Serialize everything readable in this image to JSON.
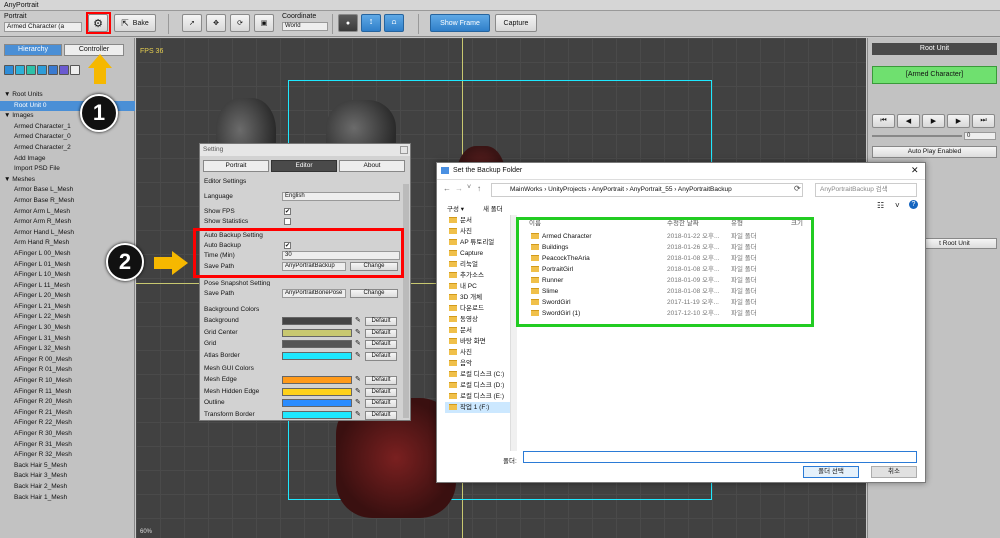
{
  "app": {
    "title": "AnyPortrait"
  },
  "toolbar": {
    "portrait_label": "Portrait",
    "portrait_value": "Armed Character (a",
    "bake": "Bake",
    "coordinate_label": "Coordinate",
    "coordinate_value": "World",
    "show_frame": "Show Frame",
    "capture": "Capture"
  },
  "left": {
    "tab_hierarchy": "Hierarchy",
    "tab_controller": "Controller",
    "tree": [
      "▼ Root Units",
      "Root Unit 0",
      "▼ Images",
      "Armed Character_1",
      "Armed Character_0",
      "Armed Character_2",
      "Add Image",
      "Import PSD File",
      "▼ Meshes",
      "Armor Base L_Mesh",
      "Armor Base R_Mesh",
      "Armor Arm L_Mesh",
      "Armor Arm R_Mesh",
      "Armor Hand L_Mesh",
      "Arm Hand R_Mesh",
      "AFinger L 00_Mesh",
      "AFinger L 01_Mesh",
      "AFinger L 10_Mesh",
      "AFinger L 11_Mesh",
      "AFinger L 20_Mesh",
      "AFinger L 21_Mesh",
      "AFinger L 22_Mesh",
      "AFinger L 30_Mesh",
      "AFinger L 31_Mesh",
      "AFinger L 32_Mesh",
      "AFinger R 00_Mesh",
      "AFinger R 01_Mesh",
      "AFinger R 10_Mesh",
      "AFinger R 11_Mesh",
      "AFinger R 20_Mesh",
      "AFinger R 21_Mesh",
      "AFinger R 22_Mesh",
      "AFinger R 30_Mesh",
      "AFinger R 31_Mesh",
      "AFinger R 32_Mesh",
      "Back Hair 5_Mesh",
      "Back Hair 3_Mesh",
      "Back Hair 2_Mesh",
      "Back Hair 1_Mesh"
    ]
  },
  "viewport": {
    "fps": "FPS 36",
    "zoom": "60%"
  },
  "right": {
    "title": "Root Unit",
    "unit_name": "[Armed Character]",
    "frame_value": "0",
    "auto_play": "Auto Play Enabled",
    "root_unit_btn": "t Root Unit"
  },
  "setting": {
    "title": "Setting",
    "tabs": [
      "Portrait",
      "Editor",
      "About"
    ],
    "editor_settings": "Editor Settings",
    "language_label": "Language",
    "language_value": "English",
    "show_fps": "Show FPS",
    "show_statistics": "Show Statistics",
    "auto_backup_setting": "Auto Backup Setting",
    "auto_backup": "Auto Backup",
    "time_label": "Time (Min)",
    "time_value": "30",
    "save_path_label": "Save Path",
    "save_path_value": "AnyPortraitBackup",
    "change": "Change",
    "pose_snapshot_setting": "Pose Snapshot Setting",
    "pose_save_path_label": "Save Path",
    "pose_save_path_value": "AnyPortraitBonePose",
    "background_colors": "Background Colors",
    "mesh_gui_colors": "Mesh GUI Colors",
    "default": "Default",
    "bg_colors": [
      {
        "label": "Background",
        "color": "#444444"
      },
      {
        "label": "Grid Center",
        "color": "#c8c870"
      },
      {
        "label": "Grid",
        "color": "#555555"
      },
      {
        "label": "Atlas Border",
        "color": "#1ee8ff"
      }
    ],
    "mesh_colors": [
      {
        "label": "Mesh Edge",
        "color": "#ff9a1a"
      },
      {
        "label": "Mesh Hidden Edge",
        "color": "#ffd21a"
      },
      {
        "label": "Outline",
        "color": "#2a8cff"
      },
      {
        "label": "Transform Border",
        "color": "#1ee8ff"
      }
    ]
  },
  "dialog": {
    "title": "Set the Backup Folder",
    "path": [
      "MainWorks",
      "UnityProjects",
      "AnyPortrait",
      "AnyPortrait_55",
      "AnyPortraitBackup"
    ],
    "search_placeholder": "AnyPortraitBackup 검색",
    "organize": "구성 ▾",
    "new_folder": "새 폴더",
    "columns": {
      "name": "이름",
      "date": "수정한 날짜",
      "type": "유형",
      "size": "크기"
    },
    "sidebar": [
      "문서",
      "사진",
      "AP 튜토리얼",
      "Capture",
      "리눅얼",
      "추가소스",
      "내 PC",
      "3D 개체",
      "다운로드",
      "동영상",
      "문서",
      "바탕 화면",
      "사진",
      "음악",
      "로컬 디스크 (C:)",
      "로컬 디스크 (D:)",
      "로컬 디스크 (E:)",
      "작업 1 (F:)"
    ],
    "files": [
      {
        "name": "Armed Character",
        "date": "2018-01-22 오후...",
        "type": "파일 폴더"
      },
      {
        "name": "Buildings",
        "date": "2018-01-26 오후...",
        "type": "파일 폴더"
      },
      {
        "name": "PeacockTheAria",
        "date": "2018-01-08 오후...",
        "type": "파일 폴더"
      },
      {
        "name": "PortraitGirl",
        "date": "2018-01-08 오후...",
        "type": "파일 폴더"
      },
      {
        "name": "Runner",
        "date": "2018-01-09 오후...",
        "type": "파일 폴더"
      },
      {
        "name": "Slime",
        "date": "2018-01-08 오후...",
        "type": "파일 폴더"
      },
      {
        "name": "SwordGirl",
        "date": "2017-11-19 오후...",
        "type": "파일 폴더"
      },
      {
        "name": "SwordGirl (1)",
        "date": "2017-12-10 오후...",
        "type": "파일 폴더"
      }
    ],
    "folder_label": "폴더:",
    "select_btn": "폴더 선택",
    "cancel_btn": "취소"
  },
  "markers": [
    "1",
    "2"
  ],
  "colors": {
    "accent_red": "#ff0000",
    "accent_green": "#22cc22",
    "arrow": "#f6b800"
  }
}
